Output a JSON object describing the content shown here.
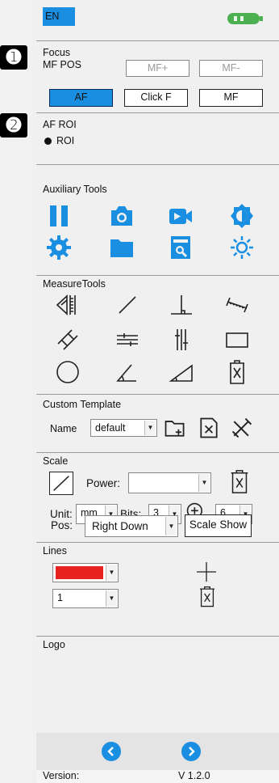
{
  "colors": {
    "accent": "#1a8ee0",
    "lines_color": "#e8231f",
    "battery": "#4caf50"
  },
  "markers": [
    "➊",
    "➋"
  ],
  "header": {
    "language": "EN",
    "battery_icon": "battery-icon"
  },
  "focus": {
    "title": "Focus",
    "mf_pos_label": "MF POS",
    "mf_plus": "MF+",
    "mf_minus": "MF-",
    "af": "AF",
    "click_f": "Click F",
    "mf": "MF"
  },
  "af_roi": {
    "title": "AF ROI",
    "option": "ROI"
  },
  "auxiliary": {
    "title": "Auxiliary Tools",
    "icons": [
      "pause-icon",
      "camera-icon",
      "video-icon",
      "brightness-icon",
      "settings-icon",
      "folder-icon",
      "image-search-icon",
      "light-icon"
    ]
  },
  "measure": {
    "title": "MeasureTools",
    "icons": [
      "angle-ruler-icon",
      "line-icon",
      "perpendicular-icon",
      "dimension-icon",
      "parallel-lines-icon",
      "horizontal-parallel-icon",
      "vertical-parallel-icon",
      "rectangle-icon",
      "circle-icon",
      "angle-icon",
      "triangle-icon",
      "trash-icon"
    ]
  },
  "template": {
    "title": "Custom Template",
    "name_label": "Name",
    "name_value": "default"
  },
  "scale": {
    "title": "Scale",
    "power_label": "Power:",
    "power_value": "",
    "unit_label": "Unit:",
    "unit_value": "mm",
    "bits_label": "Bits:",
    "bits_value": "3",
    "zoom_value": "6",
    "pos_label": "Pos:",
    "pos_value": "Right Down",
    "scale_show": "Scale Show"
  },
  "lines": {
    "title": "Lines",
    "width_value": "1"
  },
  "logo": {
    "title": "Logo"
  },
  "footer": {
    "version_label": "Version:",
    "version_value": "V 1.2.0"
  }
}
